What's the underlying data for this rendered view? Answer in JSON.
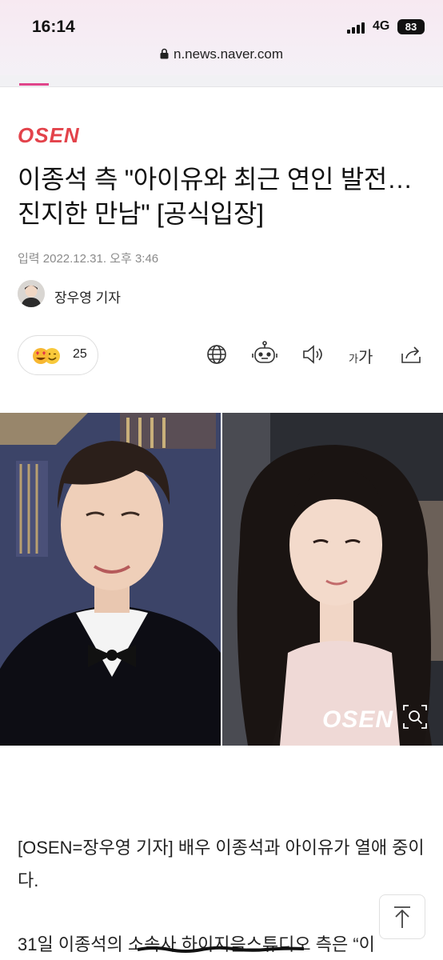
{
  "status_bar": {
    "time": "16:14",
    "network": "4G",
    "battery": "83"
  },
  "browser": {
    "url": "n.news.naver.com"
  },
  "article": {
    "source_logo": "OSEN",
    "title": "이종석 측 \"아이유와 최근 연인 발전…진지한 만남\" [공식입장]",
    "dateline": "입력 2022.12.31. 오후 3:46",
    "author": "장우영 기자",
    "reaction_count": "25",
    "font_size_label_small": "가",
    "font_size_label_big": "가",
    "photo_watermark": "OSEN",
    "paragraphs": [
      "[OSEN=장우영 기자] 배우 이종석과 아이유가 열애 중이다.",
      "31일 이종석의 소속사 하이지음스튜디오 측은 “이"
    ]
  },
  "icons": {
    "reaction": "emoji-reaction-icon",
    "translate": "globe-icon",
    "summary": "robot-icon",
    "listen": "speaker-icon",
    "share": "share-icon",
    "zoom": "zoom-icon",
    "scroll_top": "arrow-up-icon"
  },
  "colors": {
    "accent": "#e0458a",
    "osen_logo": "#e3434b"
  }
}
